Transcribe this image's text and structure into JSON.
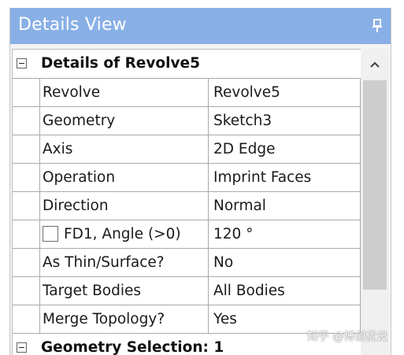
{
  "panel": {
    "title": "Details View",
    "pin_icon": "pin-icon"
  },
  "sections": {
    "details": {
      "label": "Details of Revolve5",
      "expander_icon": "collapse-minus-icon"
    },
    "geometry_selection": {
      "label": "Geometry Selection: 1",
      "expander_icon": "collapse-minus-icon"
    }
  },
  "properties": [
    {
      "label": "Revolve",
      "value": "Revolve5"
    },
    {
      "label": "Geometry",
      "value": "Sketch3"
    },
    {
      "label": "Axis",
      "value": "2D Edge"
    },
    {
      "label": "Operation",
      "value": "Imprint Faces"
    },
    {
      "label": "Direction",
      "value": "Normal"
    },
    {
      "label": "FD1,  Angle (>0)",
      "value": "120 °",
      "has_checkbox": true,
      "checked": false
    },
    {
      "label": "As Thin/Surface?",
      "value": "No"
    },
    {
      "label": "Target Bodies",
      "value": "All Bodies"
    },
    {
      "label": "Merge Topology?",
      "value": "Yes"
    }
  ],
  "scrollbar": {
    "up_icon": "chevron-up-icon"
  },
  "watermark": "知乎 @博创优设",
  "colors": {
    "titlebar": "#89b0e6",
    "grid_line": "#a9a9a9",
    "background": "#f3f3f3"
  }
}
